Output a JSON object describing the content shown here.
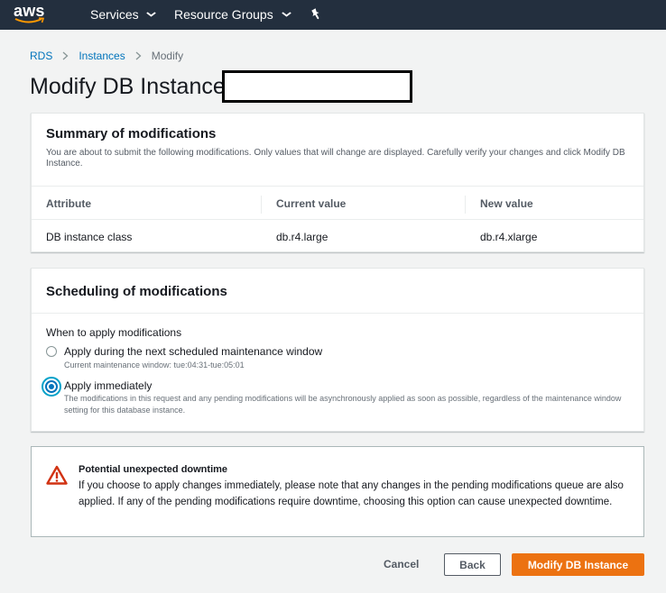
{
  "nav": {
    "logo": "aws",
    "services": "Services",
    "resource_groups": "Resource Groups",
    "chevron_icon": "chevron-down-icon",
    "pin_icon": "pushpin-icon",
    "background": "#232f3e"
  },
  "breadcrumb": {
    "items": [
      "RDS",
      "Instances",
      "Modify"
    ]
  },
  "page": {
    "title": "Modify DB Instance:"
  },
  "summary": {
    "title": "Summary of modifications",
    "description": "You are about to submit the following modifications. Only values that will change are displayed. Carefully verify your changes and click Modify DB Instance.",
    "columns": [
      "Attribute",
      "Current value",
      "New value"
    ],
    "rows": [
      [
        "DB instance class",
        "db.r4.large",
        "db.r4.xlarge"
      ]
    ]
  },
  "scheduling": {
    "title": "Scheduling of modifications",
    "field_label": "When to apply modifications",
    "options": [
      {
        "label": "Apply during the next scheduled maintenance window",
        "description": "Current maintenance window: tue:04:31-tue:05:01",
        "selected": false
      },
      {
        "label": "Apply immediately",
        "description": "The modifications in this request and any pending modifications will be asynchronously applied as soon as possible, regardless of the maintenance window setting for this database instance.",
        "selected": true
      }
    ]
  },
  "warning": {
    "icon": "warning-triangle-icon",
    "title": "Potential unexpected downtime",
    "body": "If you choose to apply changes immediately, please note that any changes in the pending modifications queue are also applied. If any of the pending modifications require downtime, choosing this option can cause unexpected downtime.",
    "color": "#d13212"
  },
  "actions": {
    "cancel": "Cancel",
    "back": "Back",
    "modify": "Modify DB Instance",
    "primary_color": "#ec7211"
  }
}
